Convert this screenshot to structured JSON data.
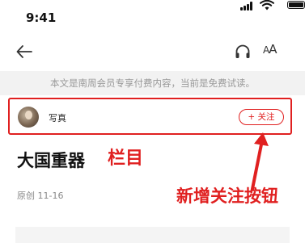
{
  "status_bar": {
    "time": "9:41",
    "icons": [
      "signal-icon",
      "wifi-icon",
      "battery-icon"
    ]
  },
  "nav": {
    "back_icon": "back-arrow-icon",
    "audio_icon": "headphones-icon",
    "font_size_big": "A",
    "font_size_small": "A"
  },
  "notice": {
    "text": "本文是南周会员专享付费内容，当前是免费试读。"
  },
  "column": {
    "name": "写真",
    "follow_label": "+ 关注"
  },
  "article": {
    "title": "大国重器",
    "meta": "原创  11-16"
  },
  "annotations": {
    "column_label": "栏目",
    "follow_label": "新增关注按钮"
  },
  "colors": {
    "accent": "#e02020",
    "notice_bg": "#f2f2f2",
    "notice_text": "#999999"
  }
}
